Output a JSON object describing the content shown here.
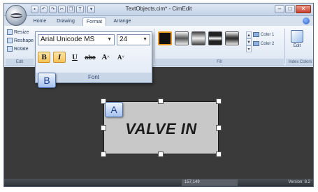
{
  "window": {
    "title": "TextObjects.cim* - CimEdit",
    "controls": [
      "–",
      "□",
      "✕"
    ]
  },
  "quick_access": {
    "items": [
      "save-icon",
      "undo-icon",
      "redo-icon",
      "cut-icon",
      "copy-icon",
      "text-icon",
      "dropdown-icon"
    ],
    "text_glyph": "T"
  },
  "tabs": [
    {
      "label": "Home",
      "active": false
    },
    {
      "label": "Drawing",
      "active": false
    },
    {
      "label": "Format",
      "active": true
    },
    {
      "label": "Arrange",
      "active": false
    }
  ],
  "ribbon": {
    "edit_group": {
      "items": [
        "Resize",
        "Reshape",
        "Rotate"
      ],
      "label": "Edit"
    },
    "fill_group": {
      "label": "Fill",
      "swatches": [
        {
          "name": "solid-black",
          "selected": true
        },
        {
          "name": "gradient-light",
          "selected": false
        },
        {
          "name": "gradient-dark",
          "selected": false
        },
        {
          "name": "gradient-band",
          "selected": false
        },
        {
          "name": "gradient-center",
          "selected": false
        }
      ],
      "color1_label": "Color 1",
      "color2_label": "Color 2"
    },
    "index_colors_group": {
      "label": "Index Colors",
      "edit_label": "Edit"
    }
  },
  "font_popup": {
    "font_name": "Arial Unicode MS",
    "font_size": "24",
    "buttons": {
      "bold": "B",
      "italic": "I",
      "underline": "U",
      "strike": "abc",
      "grow": "A",
      "shrink": "A"
    },
    "label": "Font"
  },
  "badges": {
    "a": "A",
    "b": "B"
  },
  "canvas": {
    "text_object": "VALVE IN"
  },
  "status": {
    "coords": "157,149",
    "version": "Version: 8.2"
  },
  "colors": {
    "canvas_bg": "#3a3a3a",
    "text_object_bg": "#c8c8c8",
    "ribbon_bg": "#dbe5f2",
    "selected_accent": "#f6c35a"
  }
}
